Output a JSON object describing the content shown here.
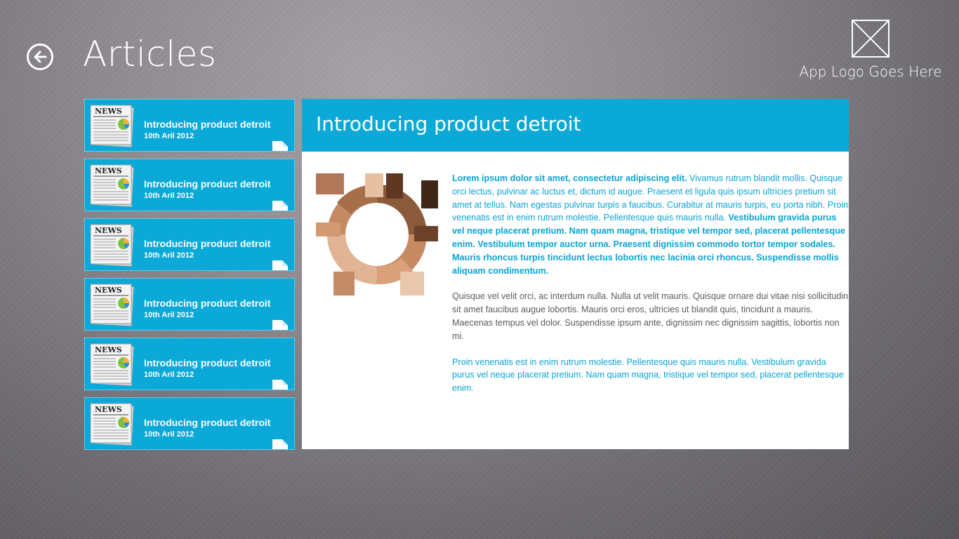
{
  "header": {
    "title": "Articles",
    "back_icon": "back-arrow-icon",
    "logo_icon": "image-placeholder-icon",
    "logo_text": "App Logo Goes Here"
  },
  "articles": [
    {
      "title": "Introducing product detroit",
      "date": "10th Aril 2012",
      "icon": "newspaper-icon"
    },
    {
      "title": "Introducing product detroit",
      "date": "10th Aril 2012",
      "icon": "newspaper-icon"
    },
    {
      "title": "Introducing product detroit",
      "date": "10th Aril 2012",
      "icon": "newspaper-icon"
    },
    {
      "title": "Introducing product detroit",
      "date": "10th Aril 2012",
      "icon": "newspaper-icon"
    },
    {
      "title": "Introducing product detroit",
      "date": "10th Aril 2012",
      "icon": "newspaper-icon"
    },
    {
      "title": "Introducing product detroit",
      "date": "10th Aril 2012",
      "icon": "newspaper-icon"
    }
  ],
  "detail": {
    "title": "Introducing product detroit",
    "image_icon": "hands-circle-photo",
    "p1_lead": "Lorem ipsum dolor sit amet, consectetur adipiscing elit.",
    "p1_mid": "  Vivamus rutrum blandit mollis. Quisque orci lectus, pulvinar ac luctus et, dictum id augue. Praesent et ligula quis ipsum ultricies pretium sit amet at tellus. Nam egestas pulvinar turpis a faucibus. Curabitur at mauris turpis, eu porta nibh. Proin venenatis est in enim rutrum molestie. Pellentesque quis mauris nulla. ",
    "p1_tail": "Vestibulum gravida purus vel neque placerat pretium. Nam quam magna, tristique vel tempor sed, placerat pellentesque enim. Vestibulum tempor auctor urna. Praesent dignissim commodo tortor tempor sodales. Mauris rhoncus turpis tincidunt lectus lobortis nec lacinia orci rhoncus. Suspendisse mollis aliquam condimentum.",
    "p2": "Quisque vel velit orci, ac interdum nulla. Nulla ut velit mauris. Quisque ornare dui vitae nisi sollicitudin sit amet faucibus augue lobortis. Mauris orci eros, ultricies ut blandit quis, tincidunt a mauris. Maecenas  tempus vel dolor. Suspendisse ipsum ante, dignissim nec dignissim sagittis, lobortis non mi.",
    "p3": "Proin venenatis est in enim rutrum molestie. Pellentesque quis mauris nulla. Vestibulum gravida purus vel neque placerat pretium. Nam quam magna, tristique vel tempor sed, placerat pellentesque enim."
  },
  "colors": {
    "accent": "#0aa9d8",
    "text_blue": "#0aa3d3",
    "text_grey": "#5a5a5a"
  }
}
